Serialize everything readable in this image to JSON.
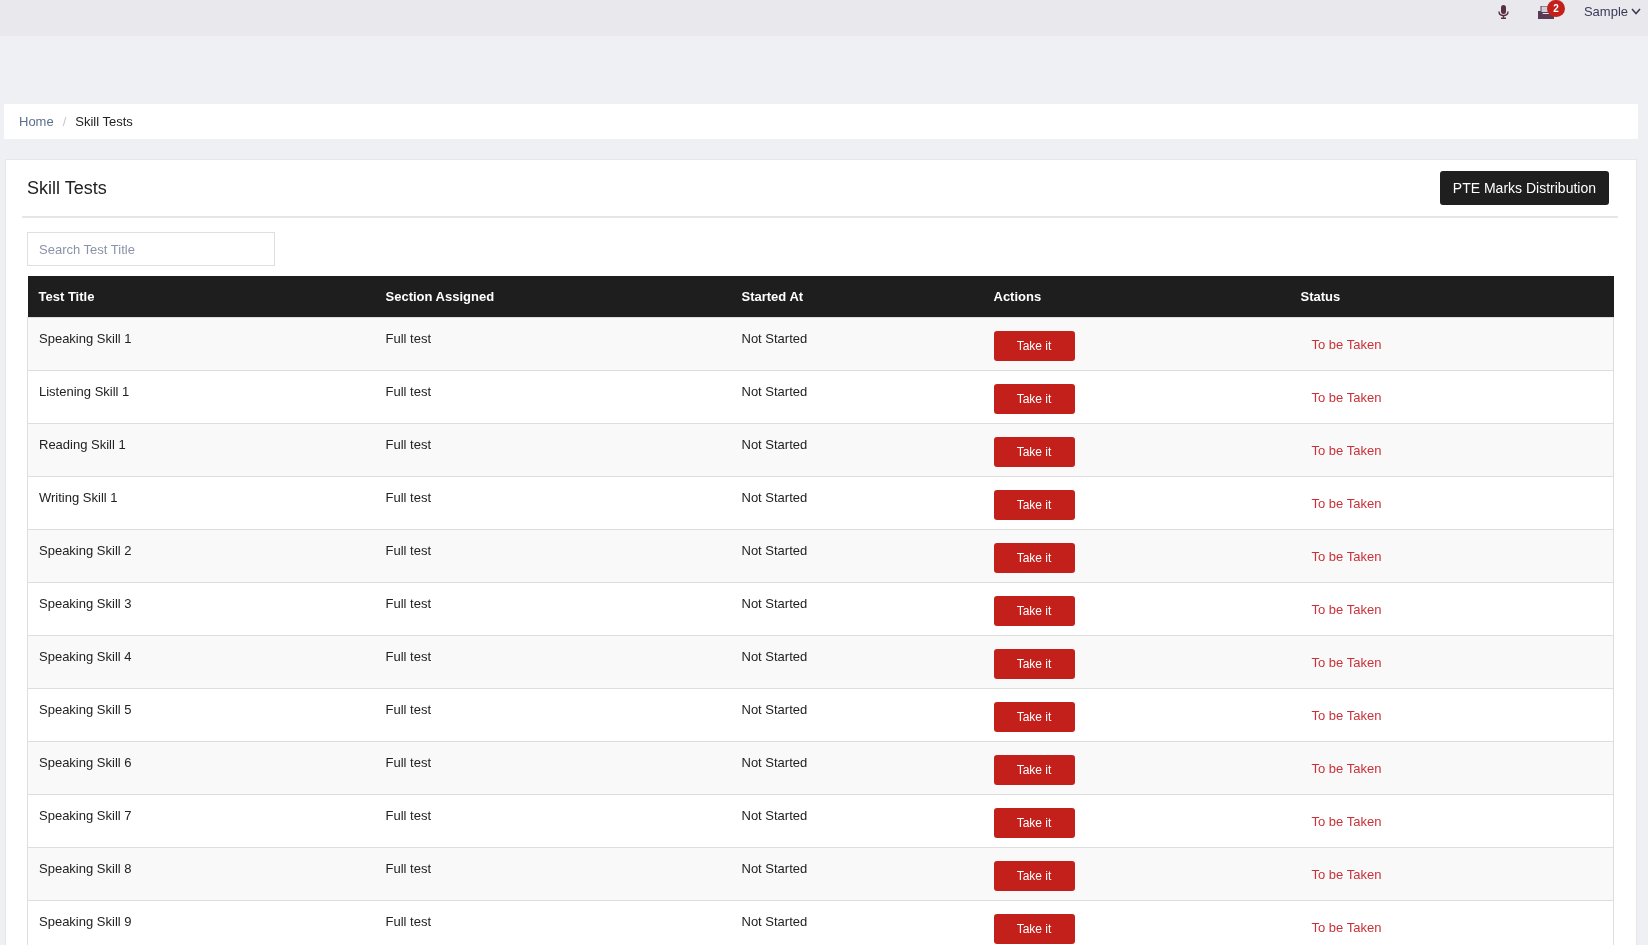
{
  "topbar": {
    "notifications_badge": "2",
    "user_menu": {
      "label": "Sample"
    }
  },
  "breadcrumb": {
    "separator": "/",
    "items": [
      {
        "label": "Home",
        "kind": "link"
      },
      {
        "label": "Skill Tests",
        "kind": "current"
      }
    ]
  },
  "card": {
    "title": "Skill Tests",
    "action_button": "PTE Marks Distribution",
    "search": {
      "placeholder": "Search Test Title"
    }
  },
  "table": {
    "columns": [
      "Test Title",
      "Section Assigned",
      "Started At",
      "Actions",
      "Status"
    ],
    "rows": [
      {
        "test_title": "Speaking Skill 1",
        "section_assigned": "Full test",
        "started_at": "Not Started",
        "action": "Take it",
        "status": "To be Taken"
      },
      {
        "test_title": "Listening Skill 1",
        "section_assigned": "Full test",
        "started_at": "Not Started",
        "action": "Take it",
        "status": "To be Taken"
      },
      {
        "test_title": "Reading Skill 1",
        "section_assigned": "Full test",
        "started_at": "Not Started",
        "action": "Take it",
        "status": "To be Taken"
      },
      {
        "test_title": "Writing Skill 1",
        "section_assigned": "Full test",
        "started_at": "Not Started",
        "action": "Take it",
        "status": "To be Taken"
      },
      {
        "test_title": "Speaking Skill 2",
        "section_assigned": "Full test",
        "started_at": "Not Started",
        "action": "Take it",
        "status": "To be Taken"
      },
      {
        "test_title": "Speaking Skill 3",
        "section_assigned": "Full test",
        "started_at": "Not Started",
        "action": "Take it",
        "status": "To be Taken"
      },
      {
        "test_title": "Speaking Skill 4",
        "section_assigned": "Full test",
        "started_at": "Not Started",
        "action": "Take it",
        "status": "To be Taken"
      },
      {
        "test_title": "Speaking Skill 5",
        "section_assigned": "Full test",
        "started_at": "Not Started",
        "action": "Take it",
        "status": "To be Taken"
      },
      {
        "test_title": "Speaking Skill 6",
        "section_assigned": "Full test",
        "started_at": "Not Started",
        "action": "Take it",
        "status": "To be Taken"
      },
      {
        "test_title": "Speaking Skill 7",
        "section_assigned": "Full test",
        "started_at": "Not Started",
        "action": "Take it",
        "status": "To be Taken"
      },
      {
        "test_title": "Speaking Skill 8",
        "section_assigned": "Full test",
        "started_at": "Not Started",
        "action": "Take it",
        "status": "To be Taken"
      },
      {
        "test_title": "Speaking Skill 9",
        "section_assigned": "Full test",
        "started_at": "Not Started",
        "action": "Take it",
        "status": "To be Taken"
      }
    ]
  }
}
